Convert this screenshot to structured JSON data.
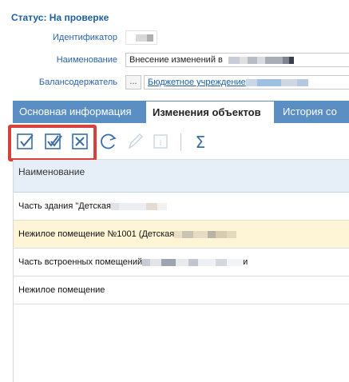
{
  "status": "Статус: На проверке",
  "fields": {
    "identifier_label": "Идентификатор",
    "name_label": "Наименование",
    "name_value": "Внесение изменений в",
    "holder_label": "Балансодержатель",
    "holder_lookup": "...",
    "holder_value": "Бюджетное учреждение"
  },
  "tabs": [
    {
      "label": "Основная информация"
    },
    {
      "label": "Изменения объектов"
    },
    {
      "label": "История со"
    }
  ],
  "toolbar": {
    "icons": [
      "check-square-icon",
      "double-check-square-icon",
      "x-square-icon",
      "refresh-icon",
      "edit-pencil-icon",
      "info-icon",
      "sum-icon"
    ],
    "sum_symbol": "Σ",
    "info_symbol": "i"
  },
  "grid": {
    "column": "Наименование",
    "rows": [
      {
        "name": "Часть здания \"Детская",
        "selected": false
      },
      {
        "name": "Нежилое помещение №1001 (Детская",
        "selected": true
      },
      {
        "name": "Часть встроенных помещений",
        "selected": false,
        "suffix": "и"
      },
      {
        "name": "Нежилое помещение",
        "selected": false
      }
    ]
  },
  "colors": {
    "accent_blue": "#5b8fc3",
    "label_blue": "#2b63a5",
    "highlight_red": "#d7413b",
    "selected_row": "#fdf5d6"
  }
}
